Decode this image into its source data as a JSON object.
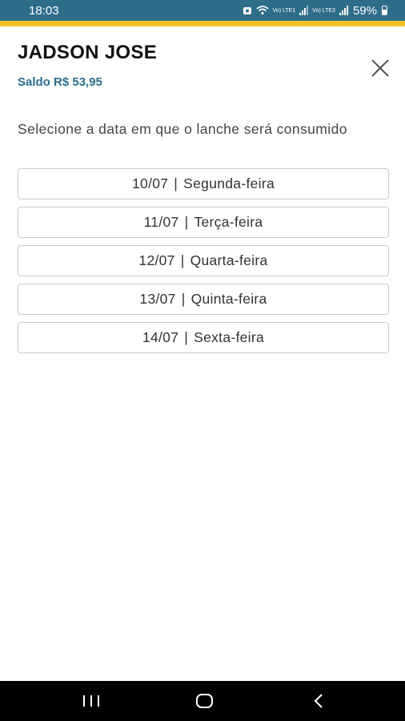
{
  "status_bar": {
    "time": "18:03",
    "network_1": "Vo) LTE1",
    "network_2": "Vo) LTE2",
    "battery": "59%"
  },
  "header": {
    "user_name": "JADSON JOSE",
    "balance": "Saldo R$ 53,95"
  },
  "instruction": "Selecione a data em que o lanche será consumido",
  "dates": [
    {
      "date": "10/07",
      "separator": "|",
      "weekday": "Segunda-feira"
    },
    {
      "date": "11/07",
      "separator": "|",
      "weekday": "Terça-feira"
    },
    {
      "date": "12/07",
      "separator": "|",
      "weekday": "Quarta-feira"
    },
    {
      "date": "13/07",
      "separator": "|",
      "weekday": "Quinta-feira"
    },
    {
      "date": "14/07",
      "separator": "|",
      "weekday": "Sexta-feira"
    }
  ],
  "icons": {
    "close": "close-icon",
    "recents": "recents-icon",
    "home": "home-icon",
    "back": "back-icon"
  },
  "colors": {
    "status_bar": "#2e6d8a",
    "accent": "#f2c12e",
    "balance_text": "#2a6f8e",
    "nav_bar": "#000000"
  }
}
